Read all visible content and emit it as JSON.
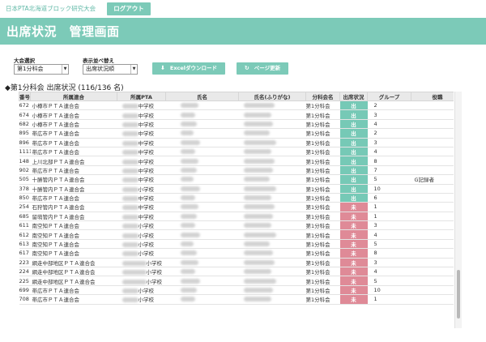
{
  "header": {
    "site_title": "日本PTA北海道ブロック研究大会",
    "logout_label": "ログアウト",
    "page_title": "出席状況　管理画面"
  },
  "controls": {
    "meeting_label": "大会選択",
    "meeting_value": "第1分科会",
    "order_label": "表示並べ替え",
    "order_value": "出席状況順",
    "excel_label": "Excelダウンロード",
    "refresh_label": "ページ更新"
  },
  "section": {
    "title": "◆第1分科会 出席状況 (116/136 名)"
  },
  "table": {
    "headers": [
      "番号",
      "所属連合",
      "所属PTA",
      "氏名",
      "氏名(ふりがな)",
      "分科会名",
      "出席状況",
      "グループ",
      "役職"
    ],
    "rows": [
      {
        "no": "672",
        "union": "小樽市ＰＴＡ連合会",
        "pta": "中学校",
        "session": "第1分科会",
        "status": "出",
        "group": "2",
        "role": ""
      },
      {
        "no": "674",
        "union": "小樽市ＰＴＡ連合会",
        "pta": "中学校",
        "session": "第1分科会",
        "status": "出",
        "group": "3",
        "role": ""
      },
      {
        "no": "682",
        "union": "小樽市ＰＴＡ連合会",
        "pta": "中学校",
        "session": "第1分科会",
        "status": "出",
        "group": "4",
        "role": ""
      },
      {
        "no": "895",
        "union": "帯広市ＰＴＡ連合会",
        "pta": "中学校",
        "session": "第1分科会",
        "status": "出",
        "group": "2",
        "role": ""
      },
      {
        "no": "896",
        "union": "帯広市ＰＴＡ連合会",
        "pta": "中学校",
        "session": "第1分科会",
        "status": "出",
        "group": "3",
        "role": ""
      },
      {
        "no": "1111",
        "union": "帯広市ＰＴＡ連合会",
        "pta": "中学校",
        "session": "第1分科会",
        "status": "出",
        "group": "4",
        "role": ""
      },
      {
        "no": "148",
        "union": "上川北部ＰＴＡ連合会",
        "pta": "中学校",
        "session": "第1分科会",
        "status": "出",
        "group": "8",
        "role": ""
      },
      {
        "no": "902",
        "union": "帯広市ＰＴＡ連合会",
        "pta": "中学校",
        "session": "第1分科会",
        "status": "出",
        "group": "7",
        "role": ""
      },
      {
        "no": "505",
        "union": "十勝管内ＰＴＡ連合会",
        "pta": "中学校",
        "session": "第1分科会",
        "status": "出",
        "group": "5",
        "role": "G記録者"
      },
      {
        "no": "378",
        "union": "十勝管内ＰＴＡ連合会",
        "pta": "小学校",
        "session": "第1分科会",
        "status": "出",
        "group": "10",
        "role": ""
      },
      {
        "no": "850",
        "union": "帯広市ＰＴＡ連合会",
        "pta": "中学校",
        "session": "第1分科会",
        "status": "出",
        "group": "6",
        "role": ""
      },
      {
        "no": "254",
        "union": "石狩管内ＰＴＡ連合会",
        "pta": "中学校",
        "session": "第1分科会",
        "status": "未",
        "group": "1",
        "role": ""
      },
      {
        "no": "685",
        "union": "留萌管内ＰＴＡ連合会",
        "pta": "中学校",
        "session": "第1分科会",
        "status": "未",
        "group": "1",
        "role": ""
      },
      {
        "no": "611",
        "union": "南空知ＰＴＡ連合会",
        "pta": "小学校",
        "session": "第1分科会",
        "status": "未",
        "group": "3",
        "role": ""
      },
      {
        "no": "612",
        "union": "南空知ＰＴＡ連合会",
        "pta": "小学校",
        "session": "第1分科会",
        "status": "未",
        "group": "4",
        "role": ""
      },
      {
        "no": "613",
        "union": "南空知ＰＴＡ連合会",
        "pta": "小学校",
        "session": "第1分科会",
        "status": "未",
        "group": "5",
        "role": ""
      },
      {
        "no": "617",
        "union": "南空知ＰＴＡ連合会",
        "pta": "小学校",
        "session": "第1分科会",
        "status": "未",
        "group": "8",
        "role": ""
      },
      {
        "no": "223",
        "union": "網走中部地区ＰＴＡ連合会",
        "pta": "小学校",
        "session": "第1分科会",
        "status": "未",
        "group": "3",
        "role": ""
      },
      {
        "no": "224",
        "union": "網走中部地区ＰＴＡ連合会",
        "pta": "小学校",
        "session": "第1分科会",
        "status": "未",
        "group": "4",
        "role": ""
      },
      {
        "no": "225",
        "union": "網走中部地区ＰＴＡ連合会",
        "pta": "小学校",
        "session": "第1分科会",
        "status": "未",
        "group": "5",
        "role": ""
      },
      {
        "no": "699",
        "union": "帯広市ＰＴＡ連合会",
        "pta": "小学校",
        "session": "第1分科会",
        "status": "未",
        "group": "10",
        "role": ""
      },
      {
        "no": "708",
        "union": "帯広市ＰＴＡ連合会",
        "pta": "小学校",
        "session": "第1分科会",
        "status": "未",
        "group": "1",
        "role": ""
      }
    ]
  },
  "colors": {
    "accent": "#7ccab8",
    "present": "#76c9b6",
    "absent": "#df8a97"
  }
}
